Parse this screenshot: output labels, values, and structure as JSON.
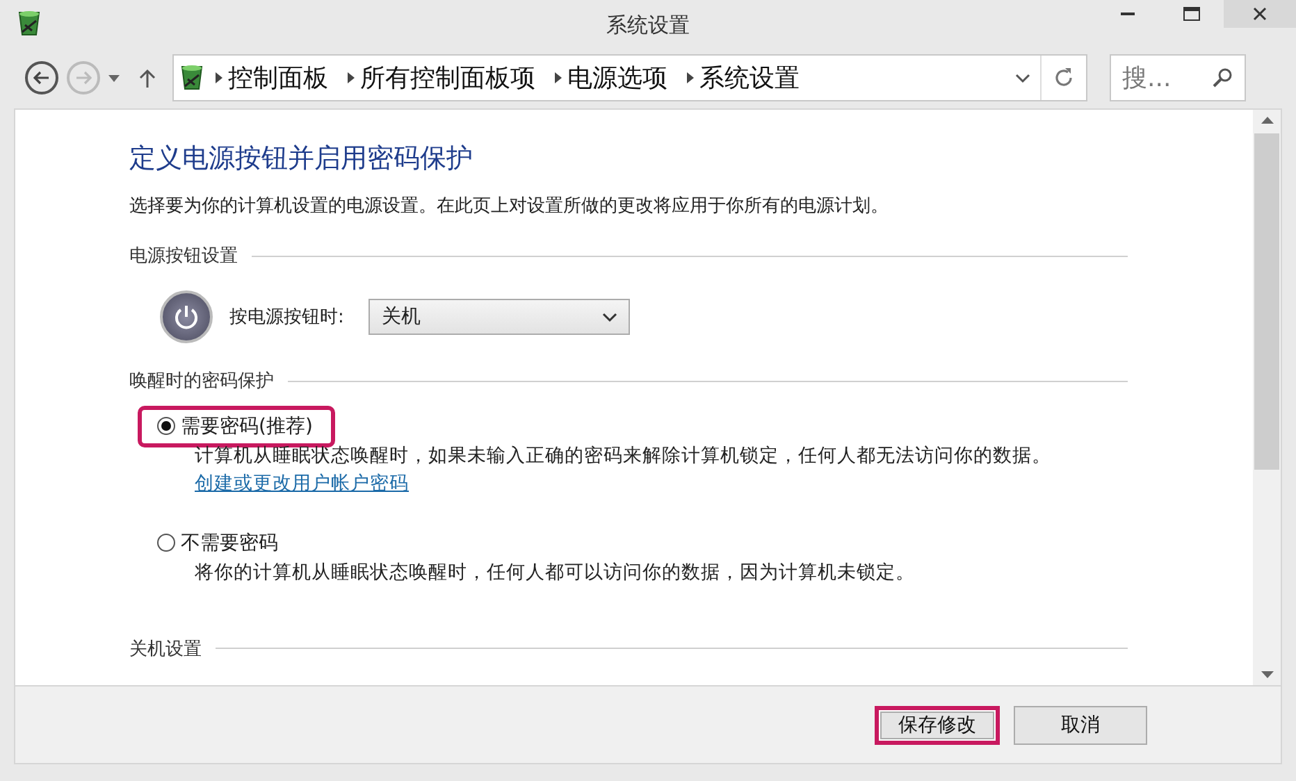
{
  "window": {
    "title": "系统设置"
  },
  "navigation": {
    "forward_disabled": true
  },
  "address_bar": {
    "crumbs": [
      "控制面板",
      "所有控制面板项",
      "电源选项",
      "系统设置"
    ]
  },
  "search": {
    "placeholder": "搜..."
  },
  "heading": "定义电源按钮并启用密码保护",
  "intro": "选择要为你的计算机设置的电源设置。在此页上对设置所做的更改将应用于你所有的电源计划。",
  "power_button": {
    "section": "电源按钮设置",
    "label": "按电源按钮时:",
    "value": "关机"
  },
  "password": {
    "section": "唤醒时的密码保护",
    "options": [
      {
        "label": "需要密码(推荐)",
        "selected": true,
        "highlighted": true,
        "description": "计算机从睡眠状态唤醒时，如果未输入正确的密码来解除计算机锁定，任何人都无法访问你的数据。",
        "link": "创建或更改用户帐户密码"
      },
      {
        "label": "不需要密码",
        "selected": false,
        "highlighted": false,
        "description": "将你的计算机从睡眠状态唤醒时，任何人都可以访问你的数据，因为计算机未锁定。"
      }
    ]
  },
  "shutdown": {
    "section": "关机设置"
  },
  "buttons": [
    {
      "label": "保存修改",
      "highlighted": true
    },
    {
      "label": "取消",
      "highlighted": false
    }
  ]
}
